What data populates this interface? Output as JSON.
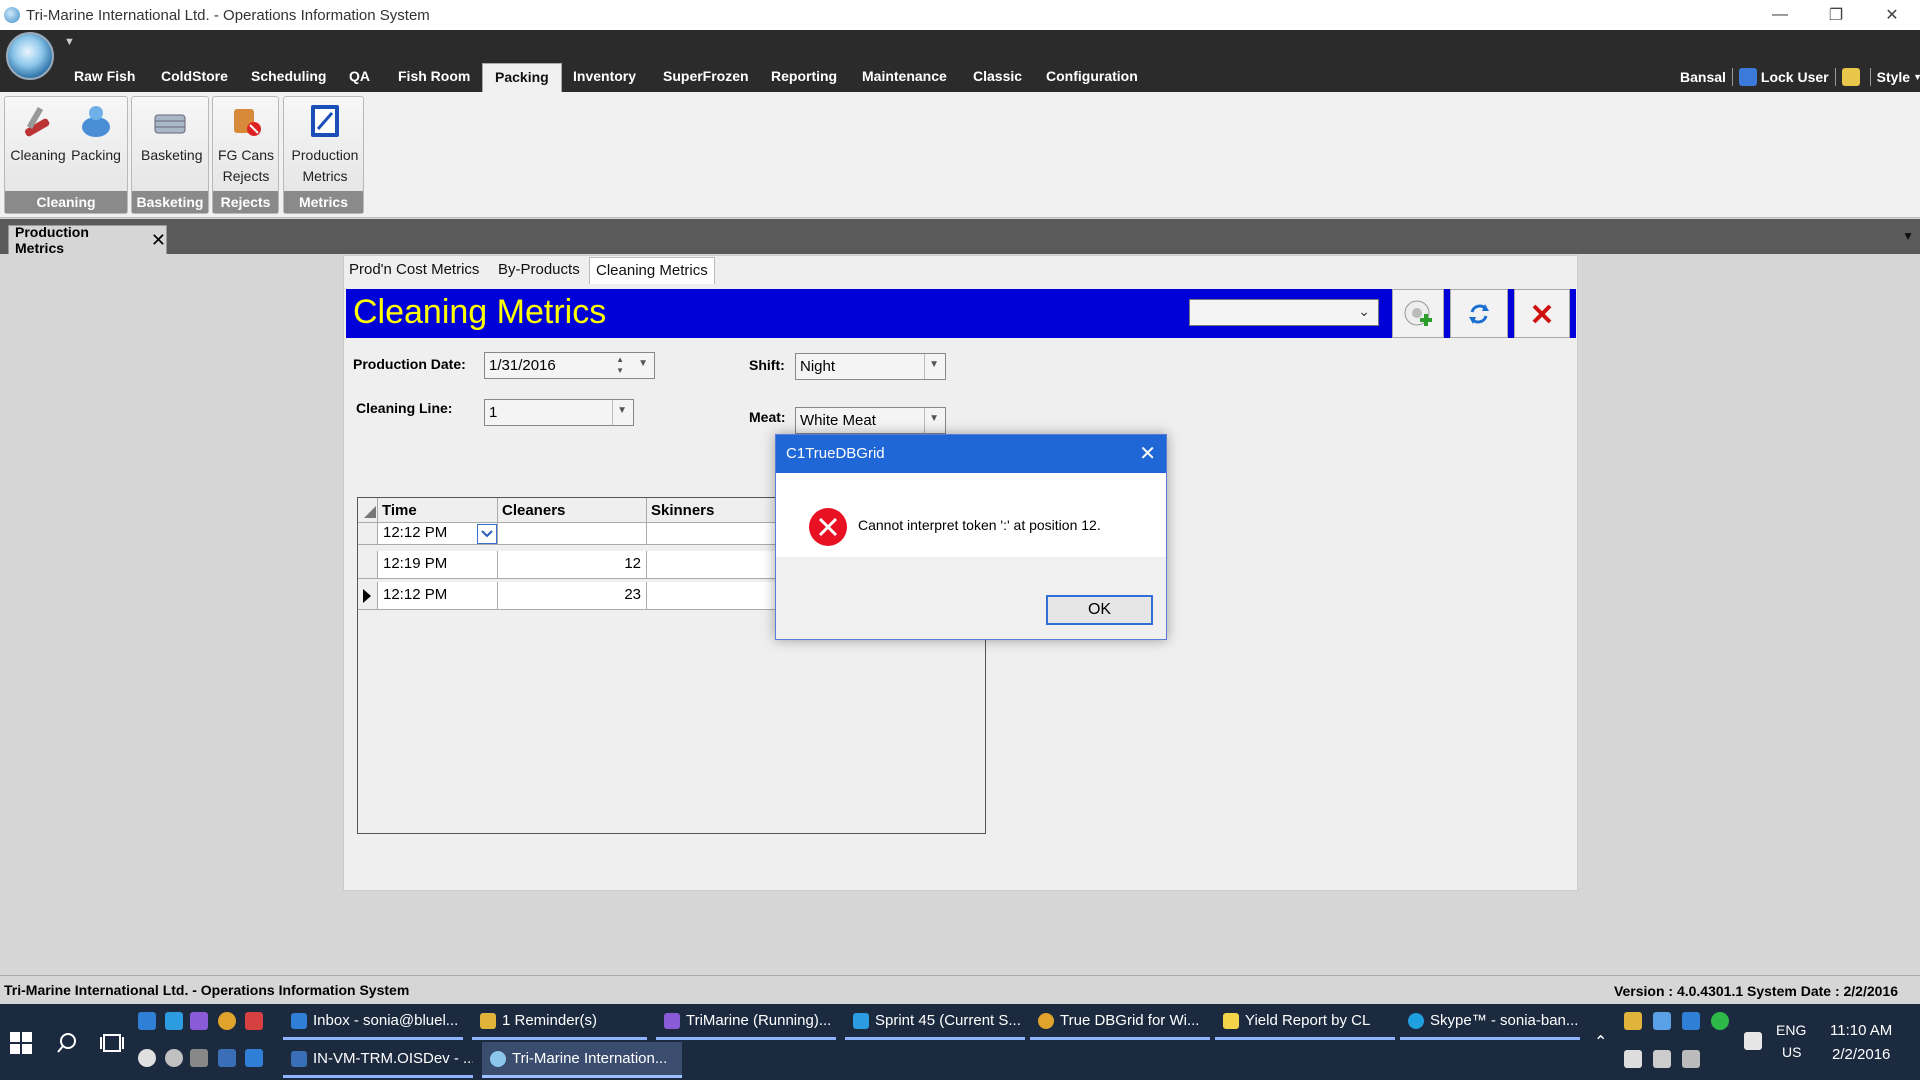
{
  "window": {
    "title": "Tri-Marine International Ltd. - Operations Information System"
  },
  "menu": {
    "items": [
      "Raw Fish",
      "ColdStore",
      "Scheduling",
      "QA",
      "Fish Room",
      "Packing",
      "Inventory",
      "SuperFrozen",
      "Reporting",
      "Maintenance",
      "Classic",
      "Configuration"
    ],
    "active": "Packing",
    "user": "Bansal",
    "lock_user": "Lock User",
    "style": "Style"
  },
  "ribbon": {
    "groups": [
      {
        "label": "Cleaning",
        "buttons": [
          "Cleaning",
          "Packing"
        ]
      },
      {
        "label": "Basketing",
        "buttons": [
          "Basketing"
        ]
      },
      {
        "label": "Rejects",
        "buttons": [
          "FG Cans Rejects"
        ]
      },
      {
        "label": "Metrics",
        "buttons": [
          "Production Metrics"
        ]
      }
    ],
    "fg_line1": "FG Cans",
    "fg_line2": "Rejects",
    "pm_line1": "Production",
    "pm_line2": "Metrics"
  },
  "doc_tab": {
    "label": "Production Metrics",
    "close": "✕"
  },
  "subtabs": [
    "Prod'n Cost Metrics",
    "By-Products",
    "Cleaning Metrics"
  ],
  "form": {
    "title": "Cleaning Metrics",
    "production_date_label": "Production Date:",
    "production_date": "1/31/2016",
    "cleaning_line_label": "Cleaning Line:",
    "cleaning_line": "1",
    "shift_label": "Shift:",
    "shift": "Night",
    "meat_label": "Meat:",
    "meat": "White Meat"
  },
  "grid": {
    "columns": [
      "Time",
      "Cleaners",
      "Skinners"
    ],
    "rows": [
      {
        "time": "12:12 PM",
        "cleaners": "",
        "skinners": ""
      },
      {
        "time": "12:19 PM",
        "cleaners": "12",
        "skinners": ""
      },
      {
        "time": "12:12 PM",
        "cleaners": "23",
        "skinners": ""
      }
    ]
  },
  "dialog": {
    "title": "C1TrueDBGrid",
    "message": "Cannot interpret token ':' at position 12.",
    "ok": "OK"
  },
  "status": {
    "left": "Tri-Marine International Ltd. - Operations Information System",
    "right": "Version : 4.0.4301.1   System Date : 2/2/2016"
  },
  "taskbar": {
    "row1": [
      "Inbox - sonia@bluel...",
      "1 Reminder(s)",
      "TriMarine (Running)...",
      "Sprint 45 (Current S...",
      "True DBGrid for Wi...",
      "Yield Report by CL",
      "Skype™ - sonia-ban..."
    ],
    "row2": [
      "IN-VM-TRM.OISDev - ...",
      "Tri-Marine Internation..."
    ],
    "lang1": "ENG",
    "lang2": "US",
    "time": "11:10 AM",
    "date": "2/2/2016"
  },
  "colors": {
    "accent_blue": "#0000d8",
    "title_yellow": "#ffff00",
    "dialog_title": "#1f66d6",
    "error_red": "#e81123"
  }
}
